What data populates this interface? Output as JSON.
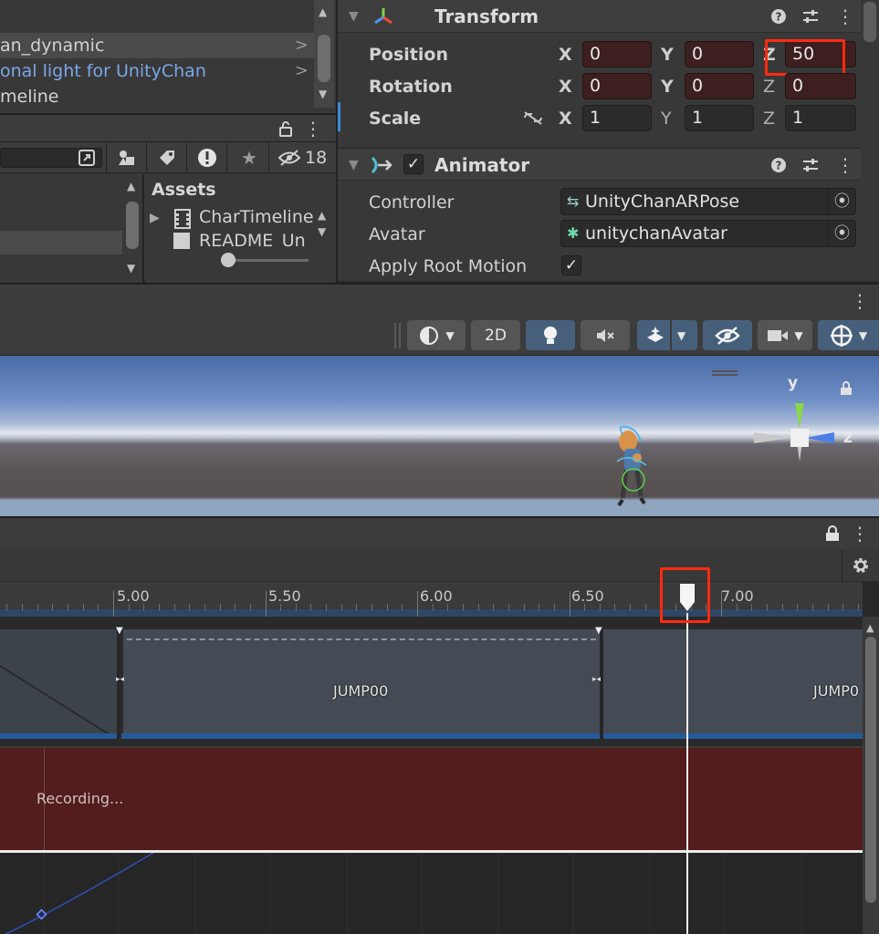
{
  "hierarchy": {
    "items": [
      {
        "label": "an_dynamic",
        "selected": true
      },
      {
        "label": "onal light for UnityChan",
        "color": "#7aa7ea"
      },
      {
        "label": "meline"
      }
    ]
  },
  "project": {
    "hidden_count": "18",
    "assets_header": "Assets",
    "assets": [
      "CharTimeline",
      "README_Un"
    ]
  },
  "inspector": {
    "transform": {
      "title": "Transform",
      "position": {
        "label": "Position",
        "x": "0",
        "y": "0",
        "z": "50"
      },
      "rotation": {
        "label": "Rotation",
        "x": "0",
        "y": "0",
        "z": "0"
      },
      "scale": {
        "label": "Scale",
        "x": "1",
        "y": "1",
        "z": "1"
      }
    },
    "animator": {
      "title": "Animator",
      "enabled": true,
      "controller_label": "Controller",
      "controller_value": "UnityChanARPose",
      "avatar_label": "Avatar",
      "avatar_value": "unitychanAvatar",
      "root_motion_label": "Apply Root Motion",
      "root_motion": true
    },
    "axis_labels": {
      "x": "X",
      "y": "Y",
      "z": "Z"
    }
  },
  "scene": {
    "toolbar": {
      "mode_2d": "2D"
    },
    "gizmo": {
      "y": "y",
      "z": "z"
    }
  },
  "timeline": {
    "ruler_labels": [
      "5.00",
      "5.50",
      "6.00",
      "6.50",
      "7.00"
    ],
    "clips": [
      "JUMP00",
      "JUMP0"
    ],
    "recording_text": "Recording..."
  },
  "colors": {
    "accent_highlight": "#ff2a10",
    "recording_track": "#531c1d",
    "toggle_on": "#46607c"
  }
}
